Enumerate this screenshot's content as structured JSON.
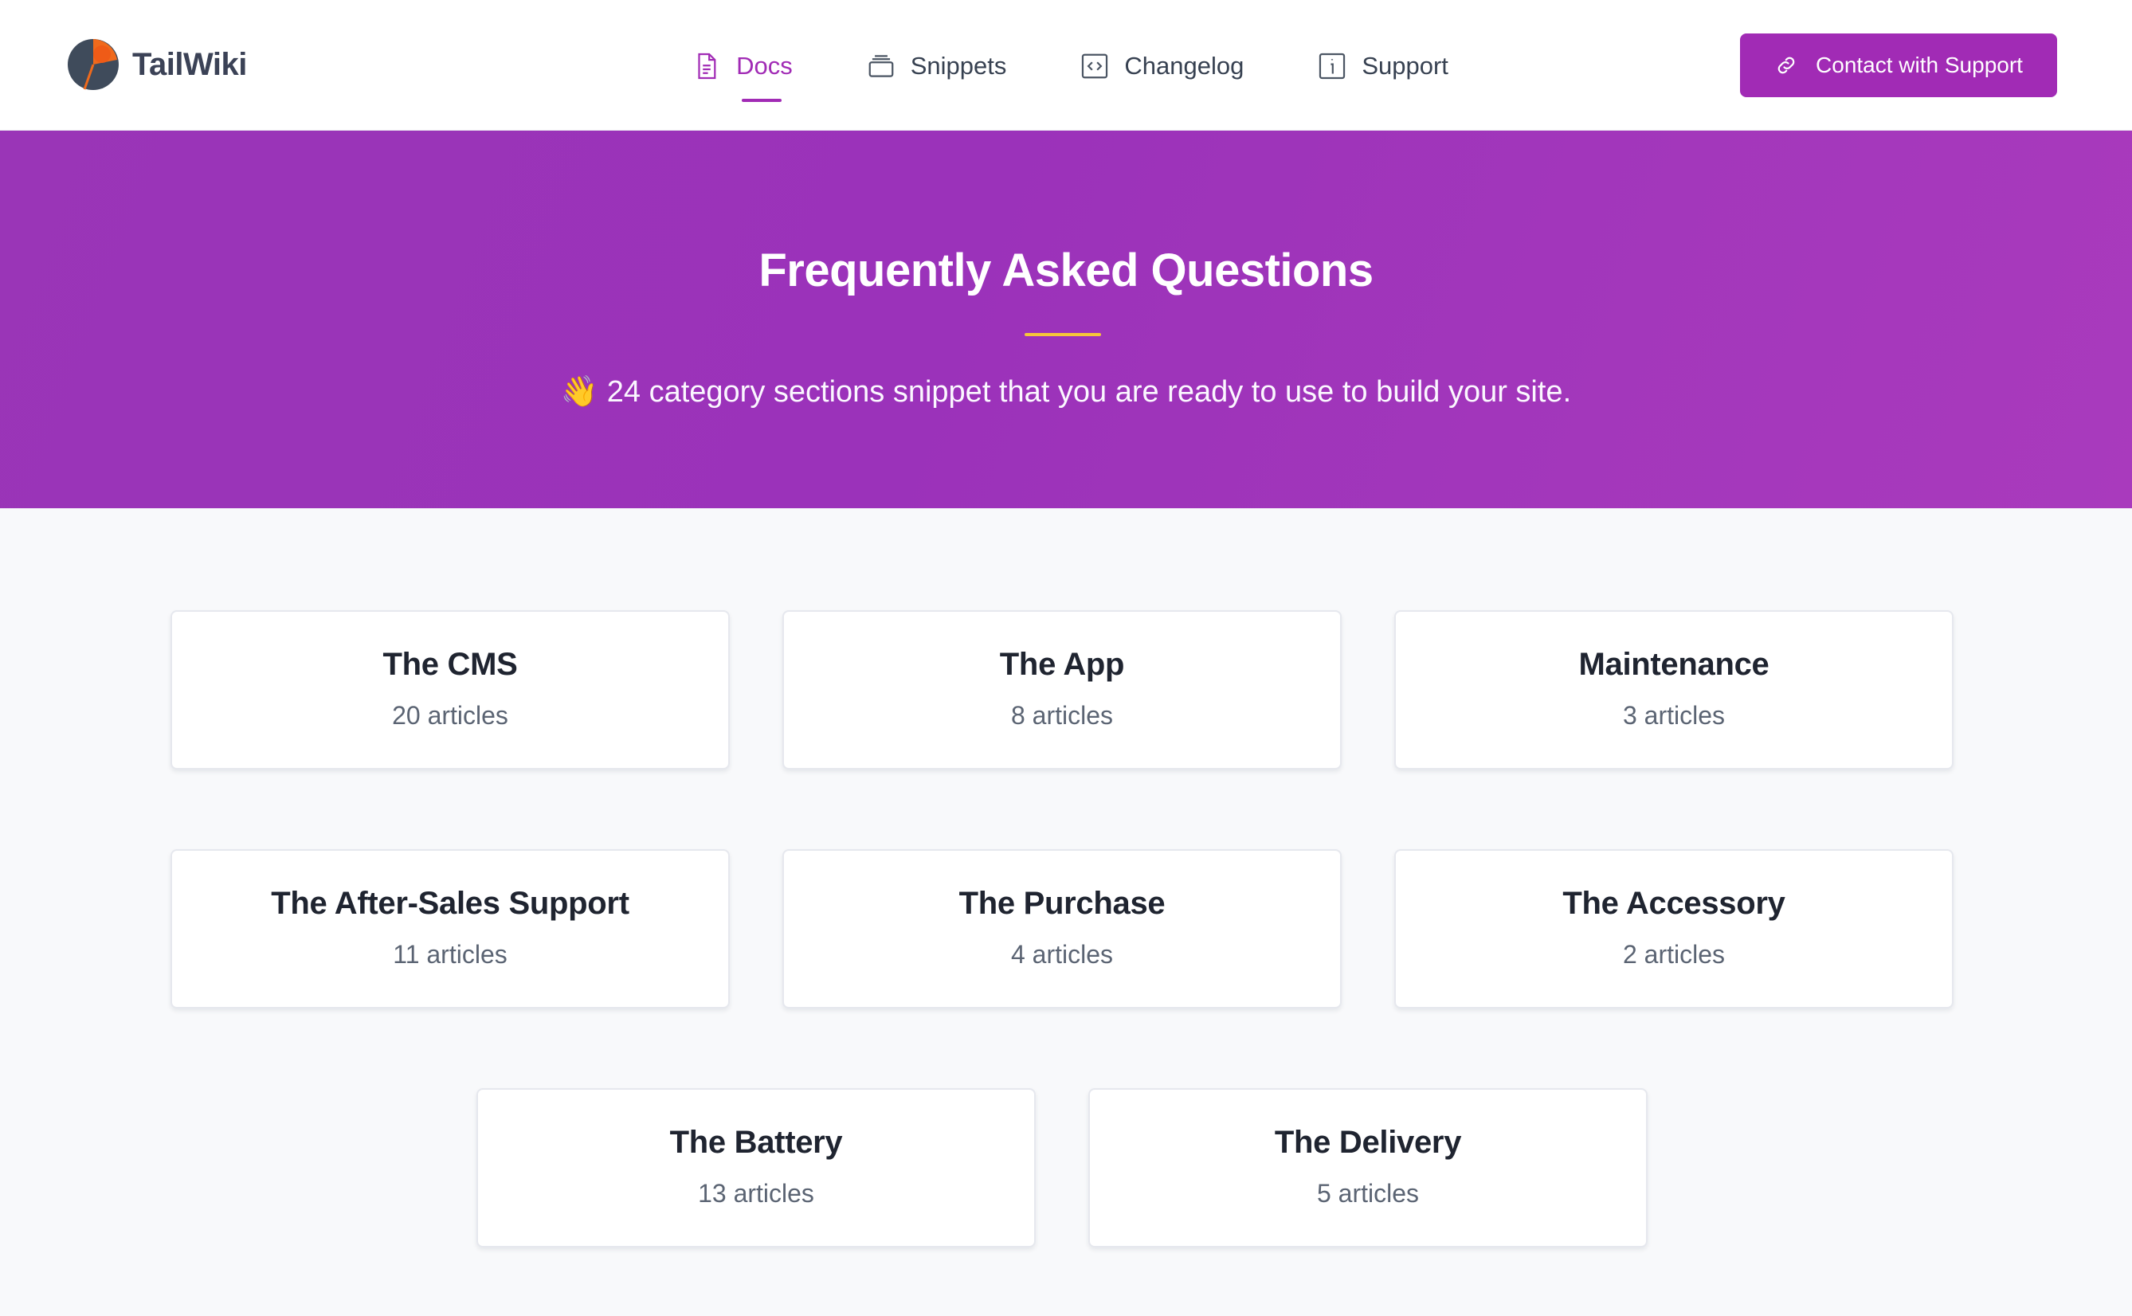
{
  "brand": {
    "name": "TailWiki"
  },
  "nav": {
    "items": [
      {
        "label": "Docs",
        "icon": "document-icon",
        "active": true
      },
      {
        "label": "Snippets",
        "icon": "stack-icon",
        "active": false
      },
      {
        "label": "Changelog",
        "icon": "code-icon",
        "active": false
      },
      {
        "label": "Support",
        "icon": "info-icon",
        "active": false
      }
    ]
  },
  "cta": {
    "label": "Contact with Support",
    "icon": "link-icon"
  },
  "hero": {
    "title": "Frequently Asked Questions",
    "subtitle": "👋 24 category sections snippet that you are ready to use to build your site."
  },
  "categories": [
    {
      "title": "The CMS",
      "count": "20 articles"
    },
    {
      "title": "The App",
      "count": "8 articles"
    },
    {
      "title": "Maintenance",
      "count": "3 articles"
    },
    {
      "title": "The After-Sales Support",
      "count": "11 articles"
    },
    {
      "title": "The Purchase",
      "count": "4 articles"
    },
    {
      "title": "The Accessory",
      "count": "2 articles"
    },
    {
      "title": "The Battery",
      "count": "13 articles"
    },
    {
      "title": "The Delivery",
      "count": "5 articles"
    }
  ],
  "colors": {
    "accent": "#a12bb5",
    "hero_bg": "#9b33b9",
    "divider": "#f6c63a",
    "page_bg": "#f8f9fb"
  }
}
